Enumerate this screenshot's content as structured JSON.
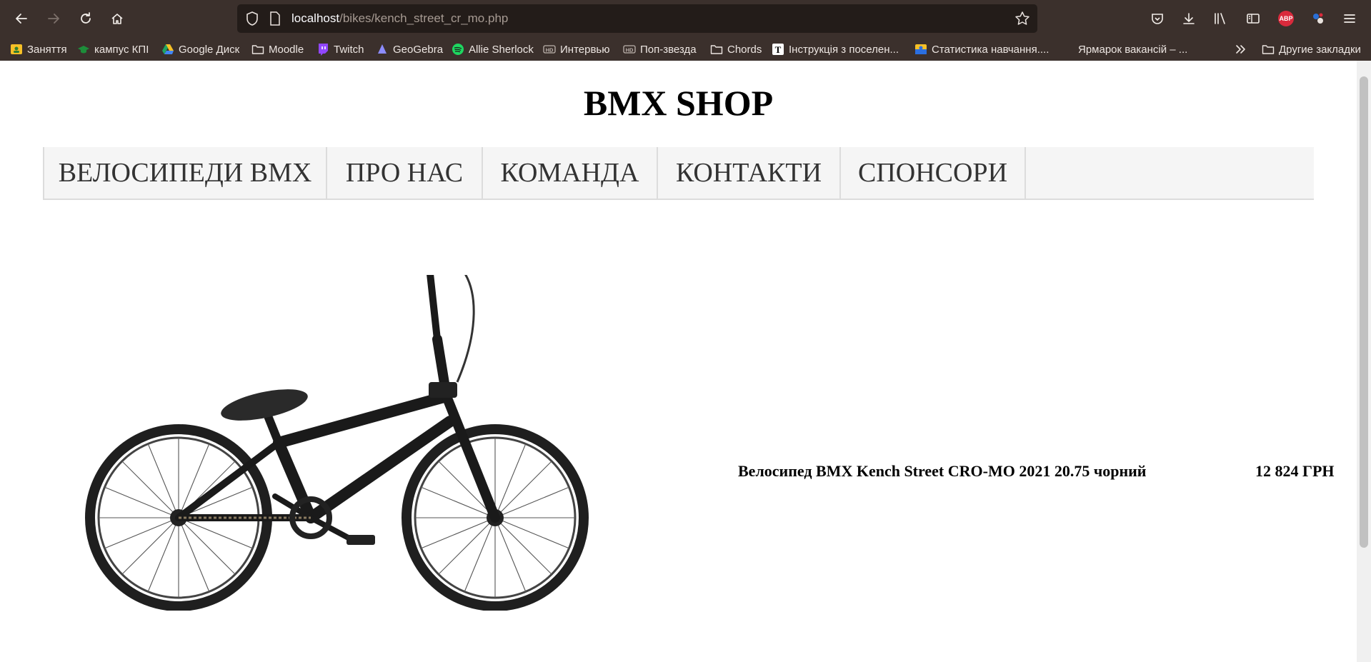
{
  "browser": {
    "url_host": "localhost",
    "url_path": "/bikes/kench_street_cr_mo.php",
    "abp_label": "ABP",
    "bookmarks": [
      {
        "label": "Заняття",
        "icon": "classroom-icon"
      },
      {
        "label": "кампус КПІ",
        "icon": "campus-icon"
      },
      {
        "label": "Google Диск",
        "icon": "google-drive-icon"
      },
      {
        "label": "Moodle",
        "icon": "folder-icon"
      },
      {
        "label": "Twitch",
        "icon": "twitch-icon"
      },
      {
        "label": "GeoGebra",
        "icon": "geogebra-icon"
      },
      {
        "label": "Allie Sherlock",
        "icon": "spotify-icon"
      },
      {
        "label": "Интервью",
        "icon": "hd-icon"
      },
      {
        "label": "Поп-звезда",
        "icon": "hd-icon"
      },
      {
        "label": "Chords",
        "icon": "folder-icon"
      },
      {
        "label": "Інструкція з поселен...",
        "icon": "notion-icon"
      },
      {
        "label": "Статистика навчання....",
        "icon": "stats-icon"
      },
      {
        "label": "Ярмарок вакансій – ...",
        "icon": "none"
      }
    ],
    "other_bookmarks": "Другие закладки"
  },
  "site": {
    "title": "BMX SHOP"
  },
  "nav": {
    "items": [
      "ВЕЛОСИПЕДИ BMX",
      "ПРО НАС",
      "КОМАНДА",
      "КОНТАКТИ",
      "СПОНСОРИ"
    ]
  },
  "product": {
    "name": "Велосипед BMX Kench Street CRO-MO 2021 20.75 чорний",
    "price": "12 824 ГРН",
    "image": "bmx-bike-image"
  },
  "colors": {
    "chrome_bg": "#3b302c",
    "url_bg": "#231c19",
    "nav_bg": "#f5f5f5",
    "nav_text": "#333333"
  }
}
